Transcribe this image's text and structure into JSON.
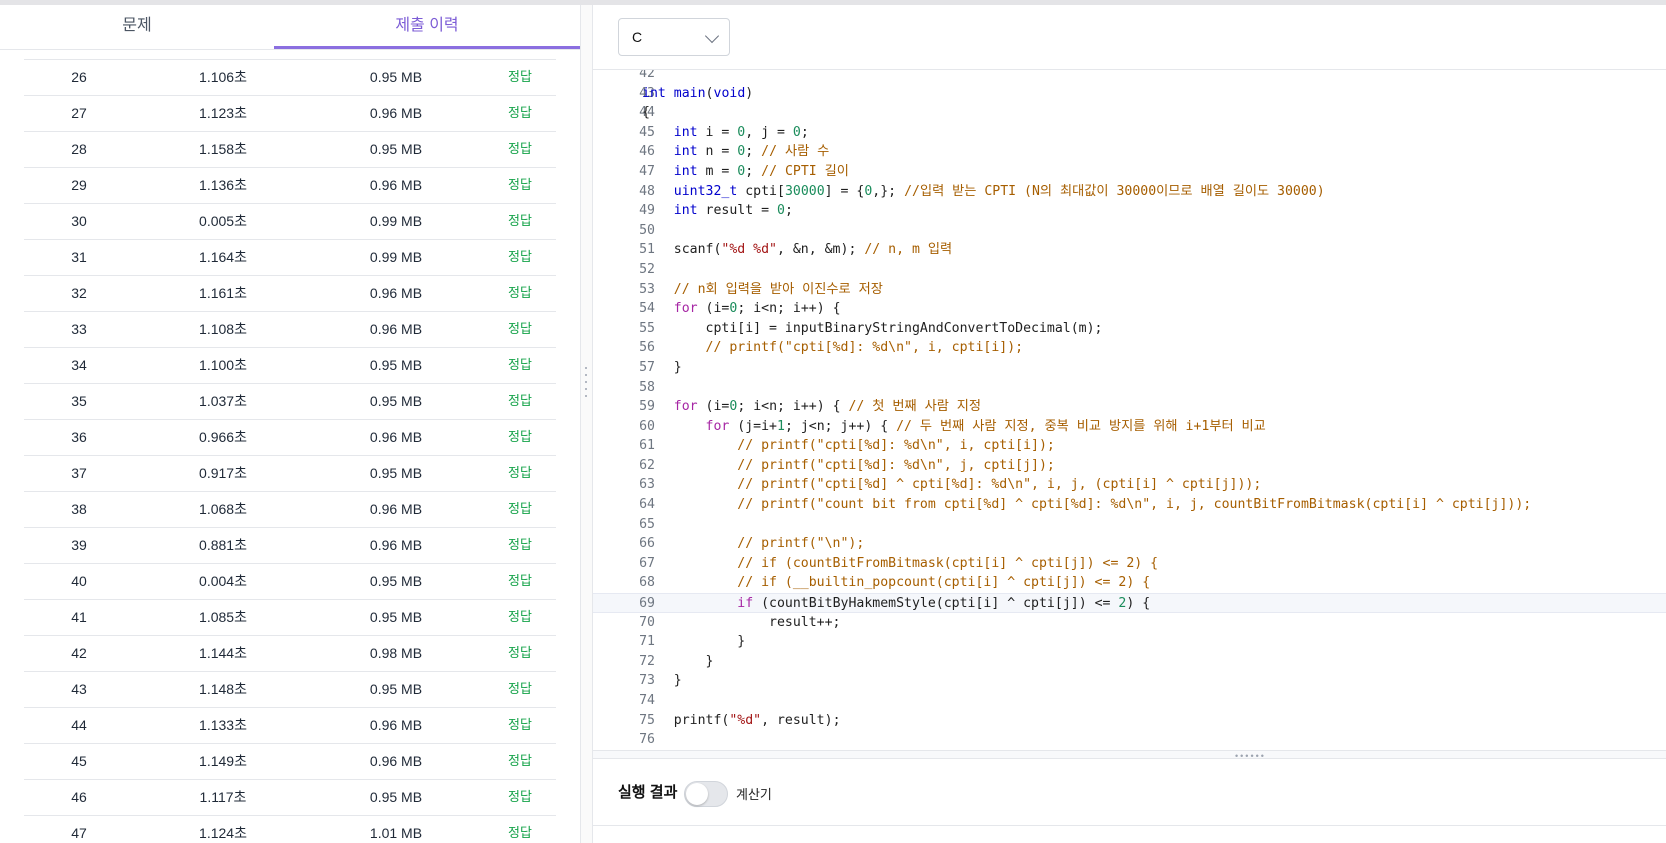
{
  "tabs": [
    {
      "label": "문제",
      "active": false
    },
    {
      "label": "제출 이력",
      "active": true
    }
  ],
  "submissions": [
    {
      "no": "26",
      "time": "1.106초",
      "memory": "0.95 MB",
      "result": "정답"
    },
    {
      "no": "27",
      "time": "1.123초",
      "memory": "0.96 MB",
      "result": "정답"
    },
    {
      "no": "28",
      "time": "1.158초",
      "memory": "0.95 MB",
      "result": "정답"
    },
    {
      "no": "29",
      "time": "1.136초",
      "memory": "0.96 MB",
      "result": "정답"
    },
    {
      "no": "30",
      "time": "0.005초",
      "memory": "0.99 MB",
      "result": "정답"
    },
    {
      "no": "31",
      "time": "1.164초",
      "memory": "0.99 MB",
      "result": "정답"
    },
    {
      "no": "32",
      "time": "1.161초",
      "memory": "0.96 MB",
      "result": "정답"
    },
    {
      "no": "33",
      "time": "1.108초",
      "memory": "0.96 MB",
      "result": "정답"
    },
    {
      "no": "34",
      "time": "1.100초",
      "memory": "0.95 MB",
      "result": "정답"
    },
    {
      "no": "35",
      "time": "1.037초",
      "memory": "0.95 MB",
      "result": "정답"
    },
    {
      "no": "36",
      "time": "0.966초",
      "memory": "0.96 MB",
      "result": "정답"
    },
    {
      "no": "37",
      "time": "0.917초",
      "memory": "0.95 MB",
      "result": "정답"
    },
    {
      "no": "38",
      "time": "1.068초",
      "memory": "0.96 MB",
      "result": "정답"
    },
    {
      "no": "39",
      "time": "0.881초",
      "memory": "0.96 MB",
      "result": "정답"
    },
    {
      "no": "40",
      "time": "0.004초",
      "memory": "0.95 MB",
      "result": "정답"
    },
    {
      "no": "41",
      "time": "1.085초",
      "memory": "0.95 MB",
      "result": "정답"
    },
    {
      "no": "42",
      "time": "1.144초",
      "memory": "0.98 MB",
      "result": "정답"
    },
    {
      "no": "43",
      "time": "1.148초",
      "memory": "0.95 MB",
      "result": "정답"
    },
    {
      "no": "44",
      "time": "1.133초",
      "memory": "0.96 MB",
      "result": "정답"
    },
    {
      "no": "45",
      "time": "1.149초",
      "memory": "0.96 MB",
      "result": "정답"
    },
    {
      "no": "46",
      "time": "1.117초",
      "memory": "0.95 MB",
      "result": "정답"
    },
    {
      "no": "47",
      "time": "1.124초",
      "memory": "1.01 MB",
      "result": "정답"
    }
  ],
  "language": {
    "selected": "C"
  },
  "code_lines": [
    {
      "n": "42",
      "t": ""
    },
    {
      "n": "43",
      "t": "int main(void)"
    },
    {
      "n": "44",
      "t": "{"
    },
    {
      "n": "45",
      "t": "    int i = 0, j = 0;"
    },
    {
      "n": "46",
      "t": "    int n = 0; // 사람 수"
    },
    {
      "n": "47",
      "t": "    int m = 0; // CPTI 길이"
    },
    {
      "n": "48",
      "t": "    uint32_t cpti[30000] = {0,}; //입력 받는 CPTI (N의 최대값이 30000이므로 배열 길이도 30000)"
    },
    {
      "n": "49",
      "t": "    int result = 0;"
    },
    {
      "n": "50",
      "t": ""
    },
    {
      "n": "51",
      "t": "    scanf(\"%d %d\", &n, &m); // n, m 입력"
    },
    {
      "n": "52",
      "t": ""
    },
    {
      "n": "53",
      "t": "    // n회 입력을 받아 이진수로 저장"
    },
    {
      "n": "54",
      "t": "    for (i=0; i<n; i++) {"
    },
    {
      "n": "55",
      "t": "        cpti[i] = inputBinaryStringAndConvertToDecimal(m);"
    },
    {
      "n": "56",
      "t": "        // printf(\"cpti[%d]: %d\\n\", i, cpti[i]);"
    },
    {
      "n": "57",
      "t": "    }"
    },
    {
      "n": "58",
      "t": ""
    },
    {
      "n": "59",
      "t": "    for (i=0; i<n; i++) { // 첫 번째 사람 지정"
    },
    {
      "n": "60",
      "t": "        for (j=i+1; j<n; j++) { // 두 번째 사람 지정, 중복 비교 방지를 위해 i+1부터 비교"
    },
    {
      "n": "61",
      "t": "            // printf(\"cpti[%d]: %d\\n\", i, cpti[i]);"
    },
    {
      "n": "62",
      "t": "            // printf(\"cpti[%d]: %d\\n\", j, cpti[j]);"
    },
    {
      "n": "63",
      "t": "            // printf(\"cpti[%d] ^ cpti[%d]: %d\\n\", i, j, (cpti[i] ^ cpti[j]));"
    },
    {
      "n": "64",
      "t": "            // printf(\"count bit from cpti[%d] ^ cpti[%d]: %d\\n\", i, j, countBitFromBitmask(cpti[i] ^ cpti[j]));"
    },
    {
      "n": "65",
      "t": ""
    },
    {
      "n": "66",
      "t": "            // printf(\"\\n\");"
    },
    {
      "n": "67",
      "t": "            // if (countBitFromBitmask(cpti[i] ^ cpti[j]) <= 2) {"
    },
    {
      "n": "68",
      "t": "            // if (__builtin_popcount(cpti[i] ^ cpti[j]) <= 2) {"
    },
    {
      "n": "69",
      "t": "            if (countBitByHakmemStyle(cpti[i] ^ cpti[j]) <= 2) {"
    },
    {
      "n": "70",
      "t": "                result++;"
    },
    {
      "n": "71",
      "t": "            }"
    },
    {
      "n": "72",
      "t": "        }"
    },
    {
      "n": "73",
      "t": "    }"
    },
    {
      "n": "74",
      "t": ""
    },
    {
      "n": "75",
      "t": "    printf(\"%d\", result);"
    },
    {
      "n": "76",
      "t": ""
    }
  ],
  "active_line": "69",
  "run": {
    "label": "실행 결과",
    "calculator_label": "계산기",
    "calculator_on": false
  },
  "colors": {
    "accent": "#7c5cd6",
    "result_ok": "#16a34a",
    "keyword": "#a626a4",
    "type": "#0000cc",
    "number": "#1a8c5b",
    "string": "#a31515",
    "comment": "#a65e00",
    "ident_func": "#1f1f1f"
  }
}
